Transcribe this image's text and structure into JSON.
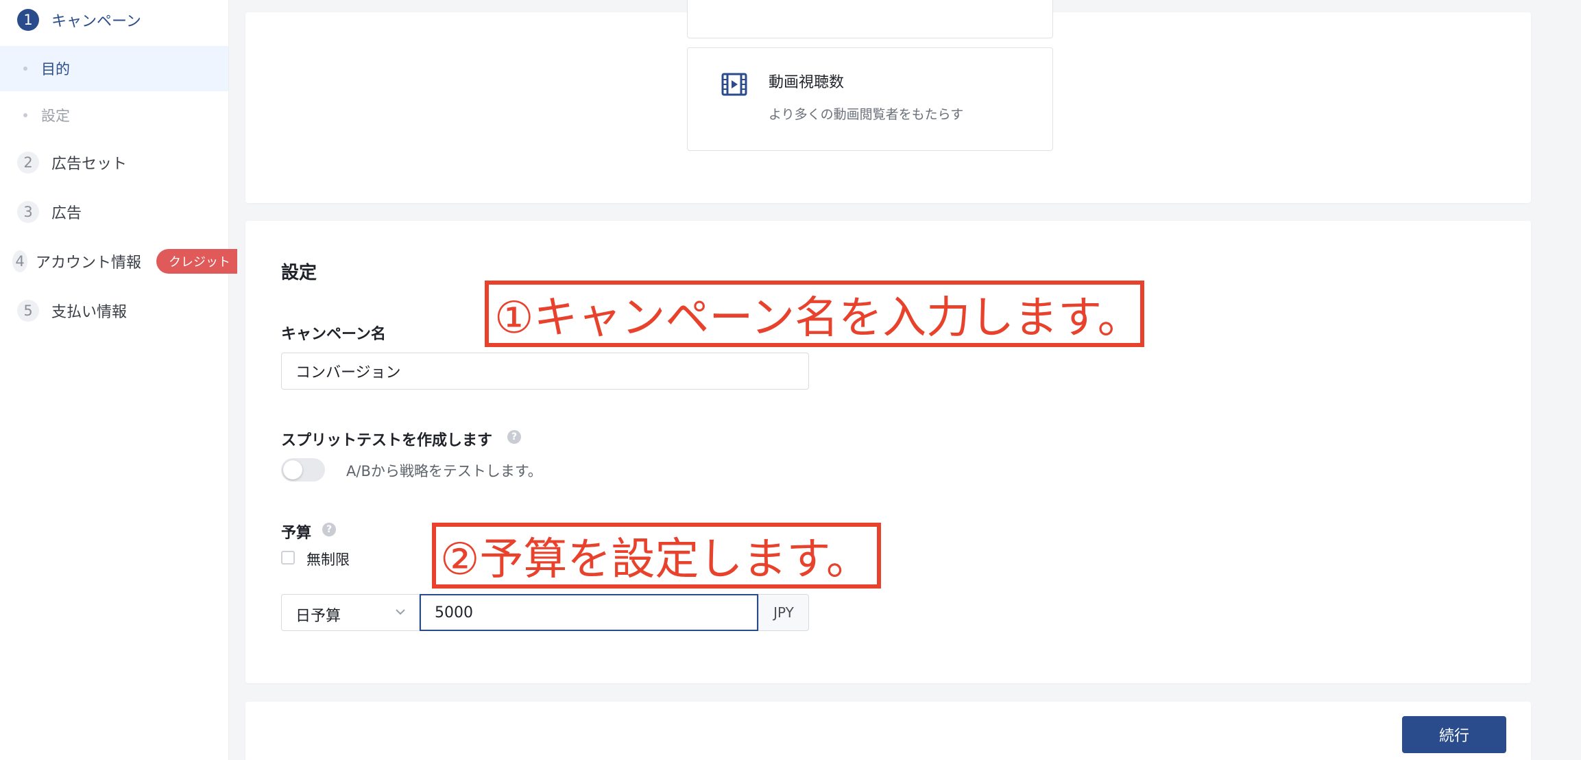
{
  "sidebar": {
    "steps": [
      {
        "num": "1",
        "label": "キャンペーン"
      },
      {
        "num": "2",
        "label": "広告セット"
      },
      {
        "num": "3",
        "label": "広告"
      },
      {
        "num": "4",
        "label": "アカウント情報"
      },
      {
        "num": "5",
        "label": "支払い情報"
      }
    ],
    "sub_items": [
      {
        "label": "目的"
      },
      {
        "label": "設定"
      }
    ],
    "credit_badge": "クレジット"
  },
  "objective": {
    "video_views": {
      "title": "動画視聴数",
      "description": "より多くの動画閲覧者をもたらす",
      "icon": "video-icon"
    }
  },
  "settings": {
    "section_title": "設定",
    "campaign_name_label": "キャンペーン名",
    "campaign_name_value": "コンバージョン",
    "split_test_label": "スプリットテストを作成します",
    "split_test_description": "A/Bから戦略をテストします。",
    "budget_label": "予算",
    "unlimited_label": "無制限",
    "budget_type": "日予算",
    "budget_value": "5000",
    "currency": "JPY"
  },
  "annotations": {
    "step1": "①キャンペーン名を入力します。",
    "step2": "②予算を設定します。"
  },
  "footer": {
    "continue_label": "続行"
  },
  "colors": {
    "primary": "#2b4c8c",
    "annotation": "#e8412c",
    "badge": "#e05a5a"
  }
}
